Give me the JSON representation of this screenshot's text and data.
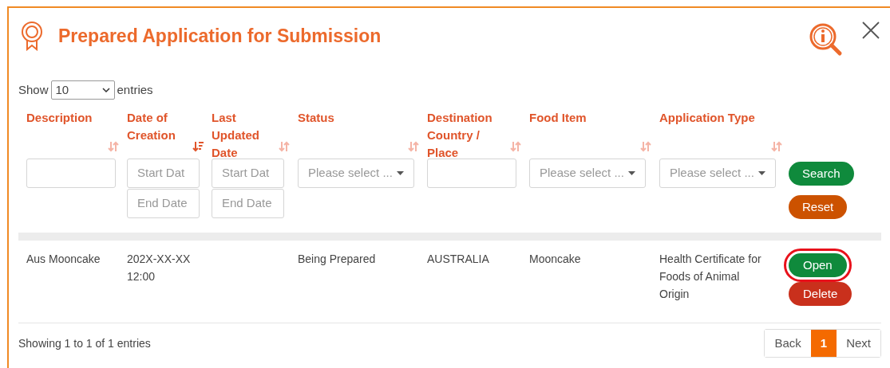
{
  "dialog": {
    "title": "Prepared Application for Submission"
  },
  "length_menu": {
    "label_before": "Show",
    "value": "10",
    "label_after": "entries"
  },
  "table": {
    "columns": [
      {
        "label": "Description",
        "sorted": false,
        "filter": {
          "kind": "text"
        }
      },
      {
        "label": "Date of Creation",
        "sorted": true,
        "filter": {
          "kind": "daterange",
          "start_placeholder": "Start Dat",
          "end_placeholder": "End Date"
        }
      },
      {
        "label": "Last Updated Date",
        "sorted": false,
        "filter": {
          "kind": "daterange",
          "start_placeholder": "Start Dat",
          "end_placeholder": "End Date"
        }
      },
      {
        "label": "Status",
        "sorted": false,
        "filter": {
          "kind": "select",
          "placeholder": "Please select ..."
        }
      },
      {
        "label": "Destination Country / Place",
        "sorted": false,
        "filter": {
          "kind": "text"
        }
      },
      {
        "label": "Food Item",
        "sorted": false,
        "filter": {
          "kind": "select",
          "placeholder": "Please select ..."
        }
      },
      {
        "label": "Application Type",
        "sorted": false,
        "filter": {
          "kind": "select",
          "placeholder": "Please select ..."
        }
      }
    ],
    "filter_buttons": [
      {
        "label": "Search",
        "kind": "search"
      },
      {
        "label": "Reset",
        "kind": "reset"
      }
    ],
    "rows": [
      {
        "cells": [
          "Aus Mooncake",
          "202X-XX-XX 12:00",
          "",
          "Being Prepared",
          "AUSTRALIA",
          "Mooncake",
          "Health Certificate for Foods of Animal Origin"
        ],
        "actions": [
          {
            "label": "Open",
            "kind": "open",
            "highlighted": true
          },
          {
            "label": "Delete",
            "kind": "delete",
            "highlighted": false
          }
        ]
      }
    ]
  },
  "footer": {
    "info": "Showing 1 to 1 of 1 entries",
    "pagination": [
      {
        "label": "Back",
        "selected": false
      },
      {
        "label": "1",
        "selected": true
      },
      {
        "label": "Next",
        "selected": false
      }
    ]
  }
}
